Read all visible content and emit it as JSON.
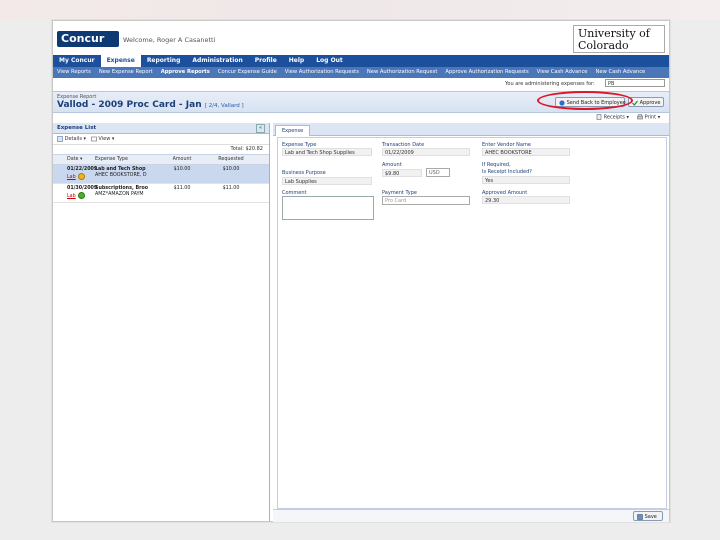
{
  "header": {
    "logo": "Concur",
    "welcome": "Welcome, Roger A Casanetti",
    "university": "University of Colorado"
  },
  "mainnav": [
    "My Concur",
    "Expense",
    "Reporting",
    "Administration",
    "Profile",
    "Help",
    "Log Out"
  ],
  "subnav": [
    "View Reports",
    "New Expense Report",
    "Approve Reports",
    "Concur Expense Guide",
    "View Authorization Requests",
    "New Authorization Request",
    "Approve Authorization Requests",
    "View Cash Advance",
    "New Cash Advance"
  ],
  "admin": {
    "label": "You are administering expenses for:",
    "value": "PB"
  },
  "report": {
    "label": "Expense Report",
    "title": "Vallod - 2009 Proc Card - Jan",
    "sub": "[ 2/4, Vallard ]"
  },
  "buttons": {
    "send_back": "Send Back to Employee",
    "approve": "Approve",
    "receipts": "Receipts",
    "print": "Print",
    "details": "Details",
    "view": "View",
    "save": "Save"
  },
  "expense_list": {
    "title": "Expense List",
    "total": "Total: $20.82",
    "columns": [
      "Date",
      "Expense Type",
      "Amount",
      "Requested"
    ],
    "rows": [
      {
        "date": "01/22/2009",
        "type": "Lab and Tech Shop",
        "vendor": "AHEC BOOKSTORE, D",
        "amount": "$10.00",
        "requested": "$10.00",
        "link": "Lab"
      },
      {
        "date": "01/30/2009",
        "type": "Subscriptions, Broo",
        "vendor": "AMZ*AMAZON PAYM",
        "amount": "$11.00",
        "requested": "$11.00",
        "link": "Lab"
      }
    ]
  },
  "tab": "Expense",
  "form": {
    "expense_type_label": "Expense Type",
    "expense_type": "Lab and Tech Shop Supplies",
    "transaction_date_label": "Transaction Date",
    "transaction_date": "01/22/2009",
    "vendor_label": "Enter Vendor Name",
    "vendor": "AHEC BOOKSTORE",
    "business_purpose_label": "Business Purpose",
    "business_purpose": "Lab Supplies",
    "amount_label": "Amount",
    "amount": "$9.80",
    "currency": "USD",
    "receipt_label": "Is Receipt Included?",
    "if_required": "If Required,",
    "receipt": "Yes",
    "comment_label": "Comment",
    "payment_type_label": "Payment Type",
    "payment_type": "Pro Card",
    "approved_amount_label": "Approved Amount",
    "approved_amount": "29.30"
  }
}
